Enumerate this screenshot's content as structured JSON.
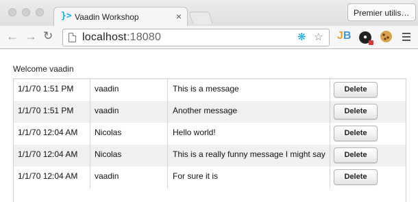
{
  "browser": {
    "tab_title": "Vaadin Workshop",
    "tab_close": "×",
    "profile_label": "Premier utilis…",
    "url_host": "localhost",
    "url_port": ":18080",
    "extensions": [
      "vaadin-debug-icon",
      "bookmark-star-icon",
      "jb-extension-icon",
      "lock-extension-icon",
      "cookie-extension-icon"
    ]
  },
  "page": {
    "welcome": "Welcome vaadin",
    "delete_label": "Delete",
    "messages": [
      {
        "date": "1/1/70 1:51 PM",
        "user": "vaadin",
        "text": "This is a message"
      },
      {
        "date": "1/1/70 1:51 PM",
        "user": "vaadin",
        "text": "Another message"
      },
      {
        "date": "1/1/70 12:04 AM",
        "user": "Nicolas",
        "text": "Hello world!"
      },
      {
        "date": "1/1/70 12:04 AM",
        "user": "Nicolas",
        "text": "This is a really funny message I might say"
      },
      {
        "date": "1/1/70 12:04 AM",
        "user": "vaadin",
        "text": "For sure it is"
      }
    ]
  },
  "colors": {
    "vaadin_accent": "#00b4f0",
    "row_alt": "#eff0f1"
  }
}
